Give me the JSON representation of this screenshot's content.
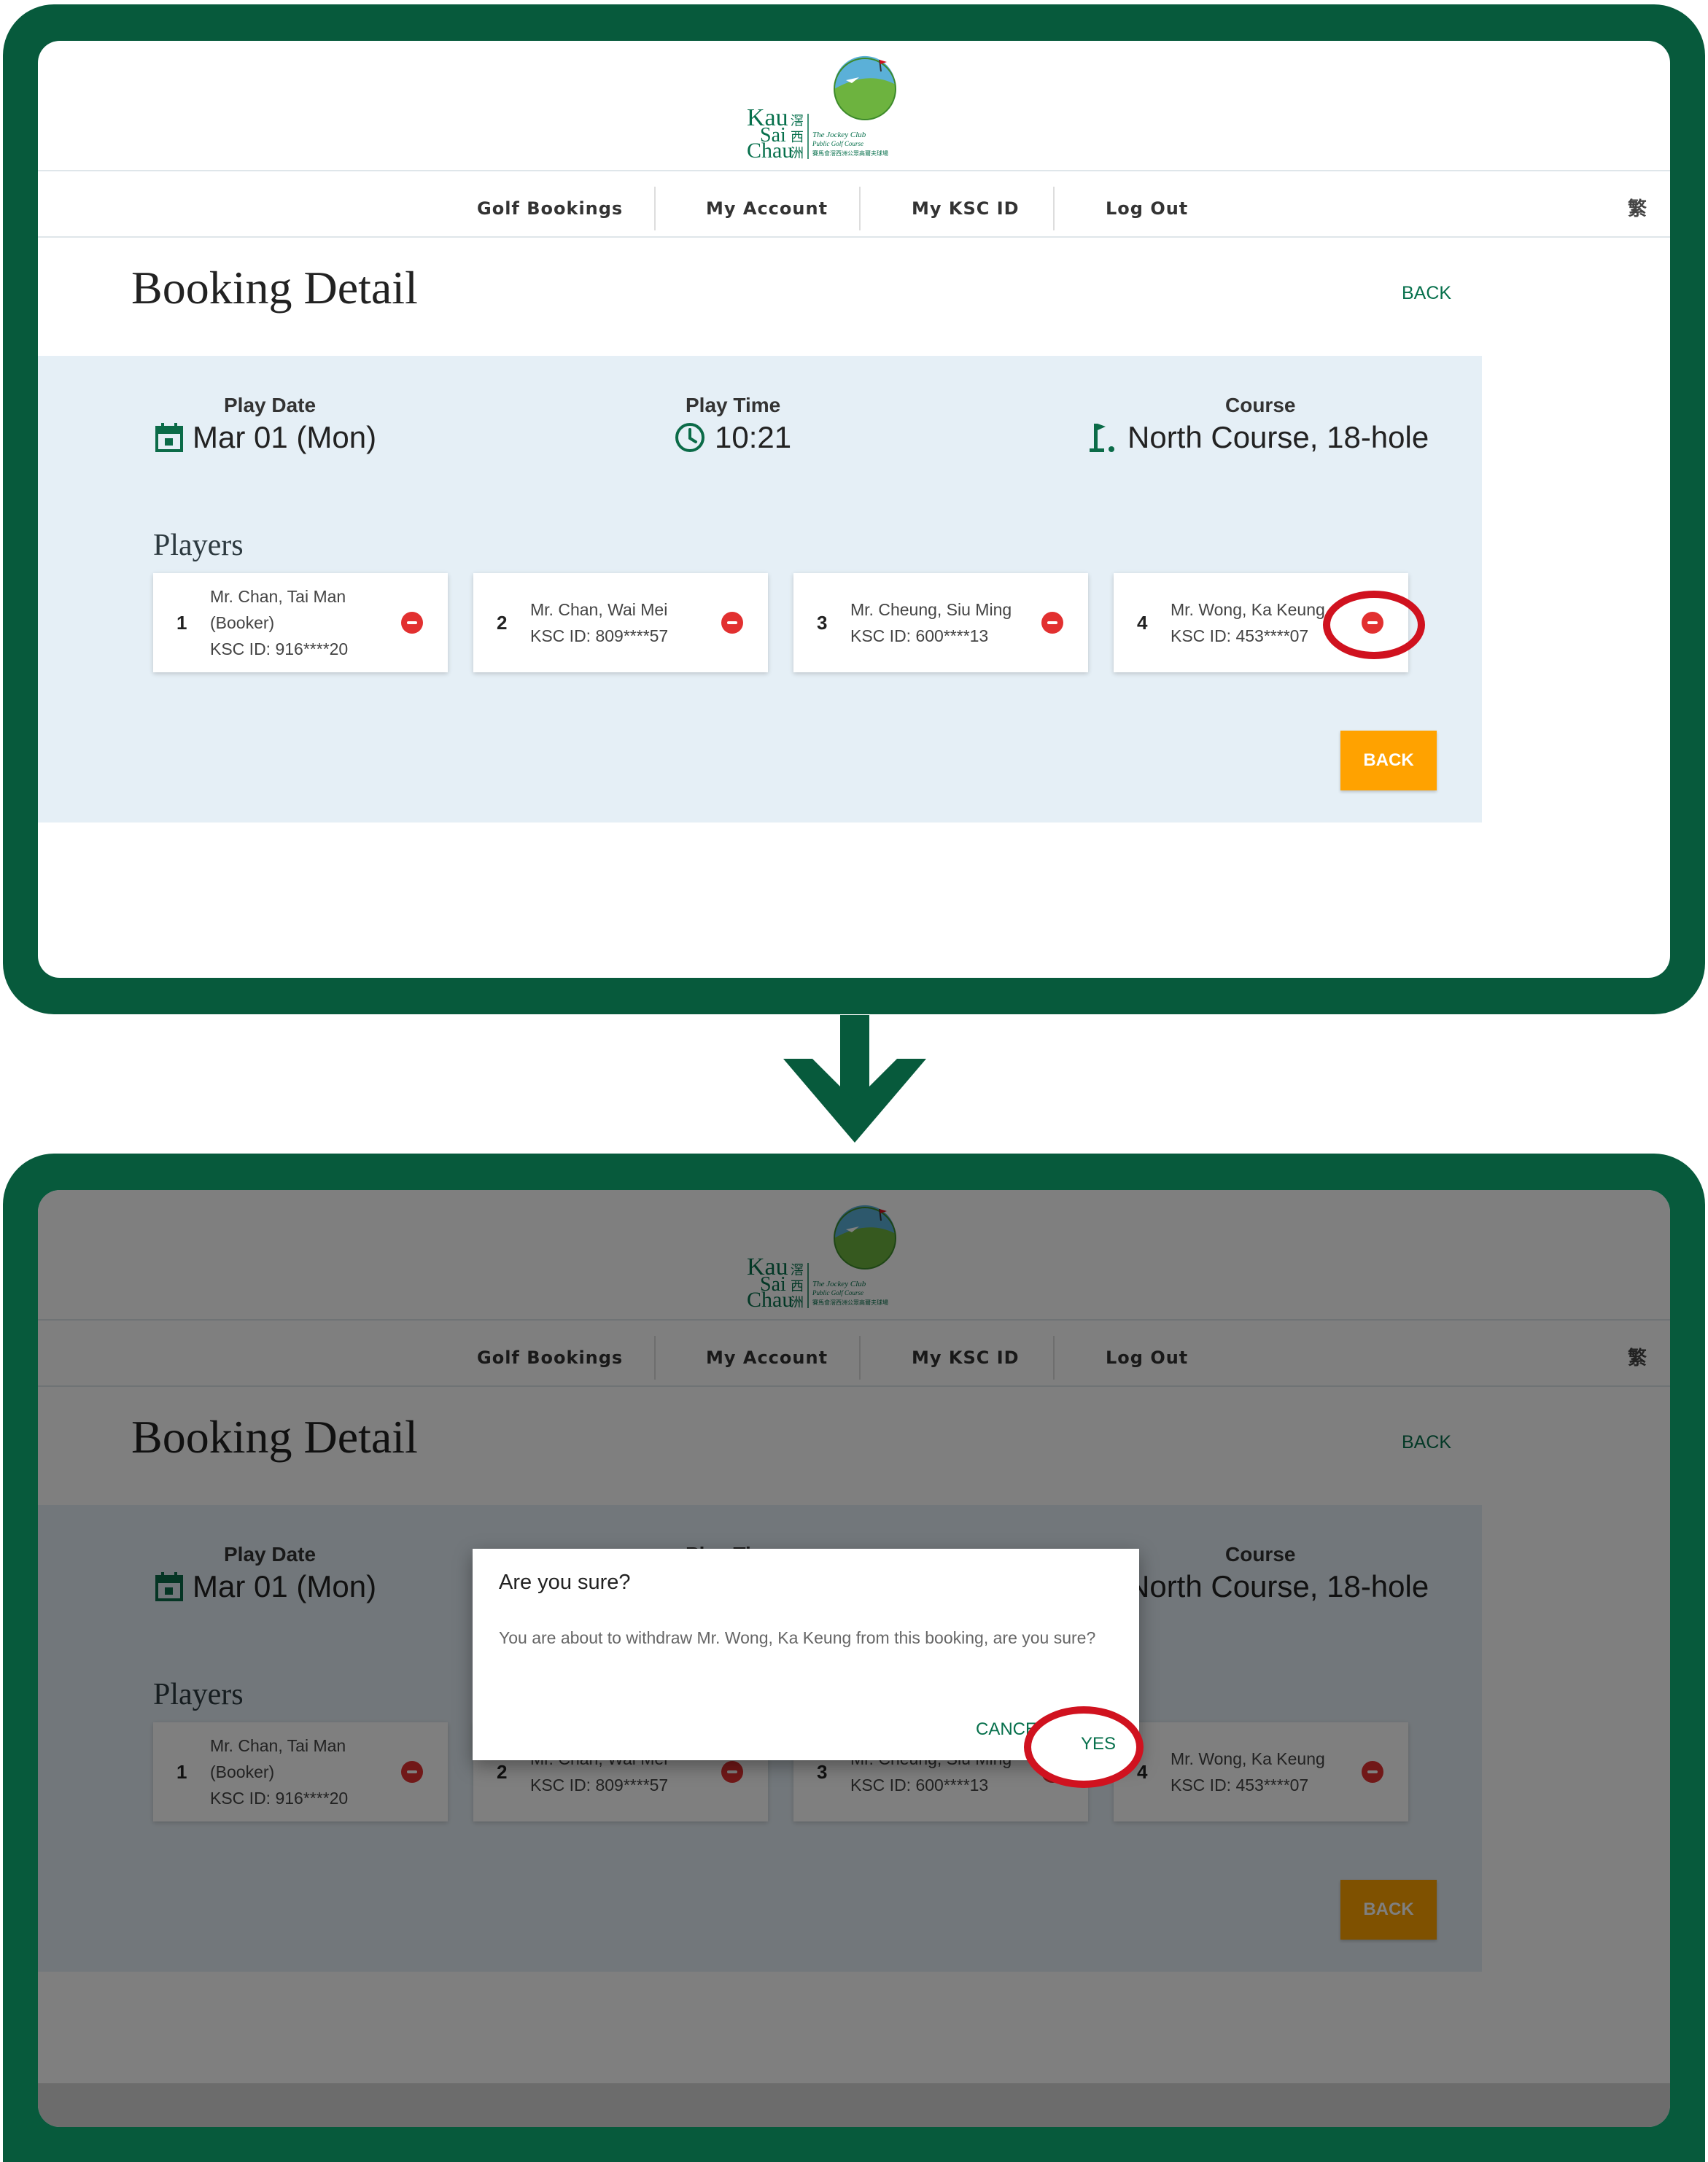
{
  "colors": {
    "brand_green": "#075a3c",
    "accent_orange": "#ffa200",
    "remove_red": "#e23030",
    "highlight_red": "#d0121f",
    "info_bg": "#e5eff6"
  },
  "logo": {
    "name_lines": [
      "Kau",
      "Sai",
      "Chau"
    ],
    "chinese_lines": [
      "滘",
      "西",
      "洲"
    ],
    "tagline_lines": [
      "The Jockey Club",
      "Public Golf Course",
      "賽馬會滘西洲公眾高爾夫球場"
    ]
  },
  "nav": {
    "items": [
      "Golf Bookings",
      "My Account",
      "My KSC ID",
      "Log Out"
    ],
    "lang_toggle": "繁"
  },
  "page": {
    "title": "Booking Detail",
    "back_link": "BACK"
  },
  "booking": {
    "play_date_label": "Play Date",
    "play_date": "Mar 01 (Mon)",
    "play_time_label": "Play Time",
    "play_time": "10:21",
    "course_label": "Course",
    "course": "North Course, 18-hole",
    "players_title": "Players",
    "players": [
      {
        "num": "1",
        "line1": "Mr. Chan, Tai Man",
        "line2": "(Booker)",
        "line3": "KSC ID: 916****20"
      },
      {
        "num": "2",
        "line1": "Mr. Chan, Wai Mei",
        "line2": "KSC ID: 809****57"
      },
      {
        "num": "3",
        "line1": "Mr. Cheung, Siu Ming",
        "line2": "KSC ID: 600****13"
      },
      {
        "num": "4",
        "line1": "Mr. Wong, Ka Keung",
        "line2": "KSC ID: 453****07"
      }
    ],
    "back_button": "BACK"
  },
  "dialog": {
    "title": "Are you sure?",
    "message": "You are about to withdraw Mr. Wong, Ka Keung from this booking, are you sure?",
    "cancel_label": "CANCEL",
    "yes_label": "YES"
  }
}
